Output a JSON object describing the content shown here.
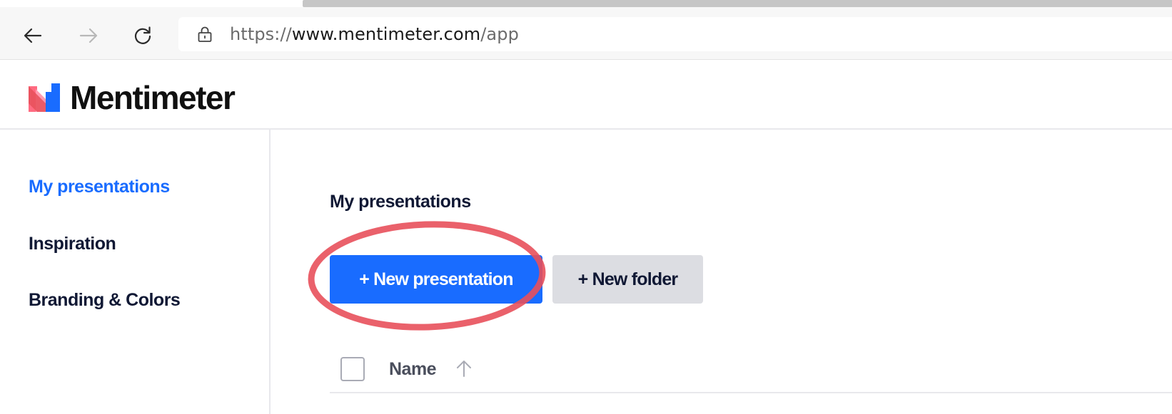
{
  "browser": {
    "url_protocol": "https://",
    "url_host": "www.mentimeter.com",
    "url_path": "/app",
    "icons": {
      "back": "arrow-left-icon",
      "forward": "arrow-right-icon",
      "reload": "reload-icon",
      "site_info": "lock-icon"
    }
  },
  "header": {
    "logo_text": "Mentimeter"
  },
  "sidebar": {
    "items": [
      {
        "label": "My presentations",
        "active": true
      },
      {
        "label": "Inspiration",
        "active": false
      },
      {
        "label": "Branding & Colors",
        "active": false
      }
    ]
  },
  "main": {
    "title": "My presentations",
    "new_presentation_label": "+ New presentation",
    "new_folder_label": "+ New folder",
    "list_header": {
      "name_label": "Name",
      "sort_icon": "arrow-up-icon"
    }
  },
  "colors": {
    "accent": "#196cff",
    "annotation": "#e8505b",
    "secondary_button": "#dcdde2"
  }
}
